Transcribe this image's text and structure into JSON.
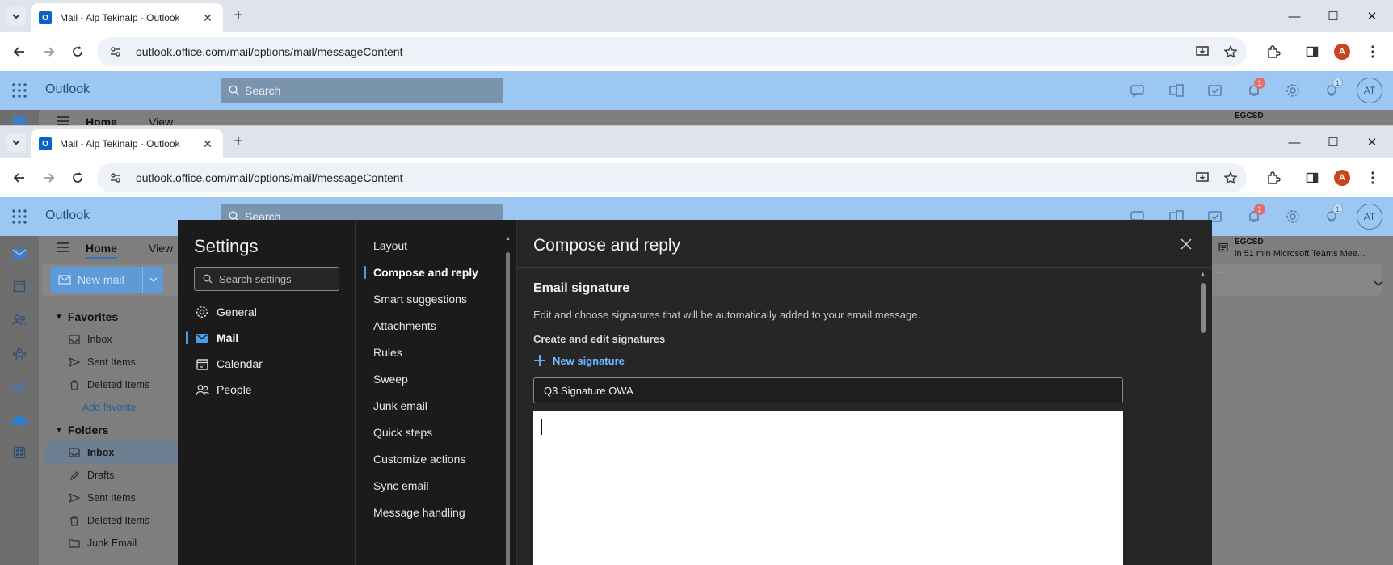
{
  "browser": {
    "tab_title": "Mail - Alp Tekinalp - Outlook",
    "favicon_letter": "O",
    "url": "outlook.office.com/mail/options/mail/messageContent",
    "profile_initial": "A"
  },
  "outlook": {
    "brand": "Outlook",
    "search_placeholder": "Search",
    "notifications_count": "1",
    "tips_count": "1",
    "user_initials": "AT",
    "ribbon_tabs": [
      "Home",
      "View"
    ],
    "new_mail_label": "New mail",
    "meeting": {
      "title": "EGCSD",
      "subtitle": "in 51 min  Microsoft Teams Mee..."
    },
    "favorites_header": "Favorites",
    "favorites": [
      "Inbox",
      "Sent Items",
      "Deleted Items"
    ],
    "add_favorite": "Add favorite",
    "folders_header": "Folders",
    "folders": [
      "Inbox",
      "Drafts",
      "Sent Items",
      "Deleted Items",
      "Junk Email"
    ],
    "more_glyph": "···"
  },
  "settings": {
    "title": "Settings",
    "search_placeholder": "Search settings",
    "categories": [
      "General",
      "Mail",
      "Calendar",
      "People"
    ],
    "active_category": "Mail",
    "subcategories": [
      "Layout",
      "Compose and reply",
      "Smart suggestions",
      "Attachments",
      "Rules",
      "Sweep",
      "Junk email",
      "Quick steps",
      "Customize actions",
      "Sync email",
      "Message handling"
    ],
    "active_subcategory": "Compose and reply",
    "content": {
      "title": "Compose and reply",
      "section_title": "Email signature",
      "description": "Edit and choose signatures that will be automatically added to your email message.",
      "create_label": "Create and edit signatures",
      "new_signature_label": "New signature",
      "signature_name": "Q3 Signature OWA"
    }
  },
  "colors": {
    "accent": "#4a9de8",
    "outlook_header": "#9bc7f2",
    "dark_panel": "#202020"
  }
}
